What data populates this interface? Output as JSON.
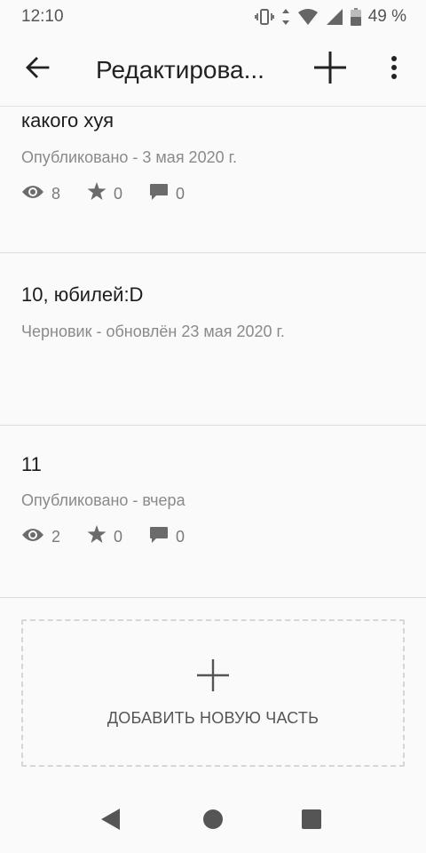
{
  "status_bar": {
    "time": "12:10",
    "battery": "49 %",
    "icons": [
      "vibrate-icon",
      "data-arrows-icon",
      "wifi-icon",
      "signal-icon",
      "battery-icon"
    ]
  },
  "app_bar": {
    "title": "Редактирова...",
    "icons": [
      "back-arrow-icon",
      "plus-icon",
      "more-vert-icon"
    ]
  },
  "parts": [
    {
      "title": "какого хуя",
      "status": "Опубликовано - 3 мая 2020 г.",
      "views": "8",
      "votes": "0",
      "comments": "0"
    },
    {
      "title": "10, юбилей:D",
      "status": "Черновик - обновлён 23 мая 2020 г."
    },
    {
      "title": "11",
      "status": "Опубликовано - вчера",
      "views": "2",
      "votes": "0",
      "comments": "0"
    }
  ],
  "add_part": {
    "label": "ДОБАВИТЬ НОВУЮ ЧАСТЬ"
  },
  "colors": {
    "background": "#fbfafb",
    "text": "#1f1f1f",
    "muted": "#8a8a8a",
    "divider": "#dcdcdc"
  }
}
